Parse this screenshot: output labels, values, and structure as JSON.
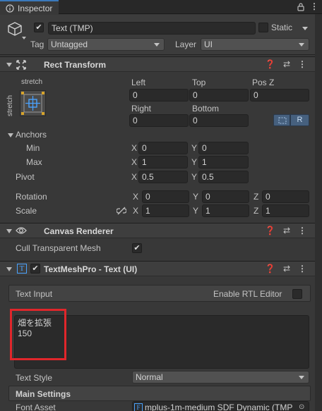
{
  "tab": {
    "title": "Inspector",
    "icon": "info-icon"
  },
  "header_icons": [
    "lock-icon",
    "kebab-menu-icon"
  ],
  "object": {
    "enabled": true,
    "name": "Text (TMP)",
    "static_label": "Static",
    "static_checked": false,
    "tag_label": "Tag",
    "tag_value": "Untagged",
    "layer_label": "Layer",
    "layer_value": "UI"
  },
  "rect_transform": {
    "title": "Rect Transform",
    "anchor_preset_top": "stretch",
    "anchor_preset_side": "stretch",
    "left_label": "Left",
    "left_value": "0",
    "top_label": "Top",
    "top_value": "0",
    "posz_label": "Pos Z",
    "posz_value": "0",
    "right_label": "Right",
    "right_value": "0",
    "bottom_label": "Bottom",
    "bottom_value": "0",
    "r_button": "R",
    "anchors_label": "Anchors",
    "min_label": "Min",
    "min_x": "0",
    "min_y": "0",
    "max_label": "Max",
    "max_x": "1",
    "max_y": "1",
    "pivot_label": "Pivot",
    "pivot_x": "0.5",
    "pivot_y": "0.5",
    "rotation_label": "Rotation",
    "rot_x": "0",
    "rot_y": "0",
    "rot_z": "0",
    "scale_label": "Scale",
    "scale_x": "1",
    "scale_y": "1",
    "scale_z": "1",
    "axis_x": "X",
    "axis_y": "Y",
    "axis_z": "Z"
  },
  "canvas_renderer": {
    "title": "Canvas Renderer",
    "cull_label": "Cull Transparent Mesh",
    "cull_checked": true
  },
  "tmp": {
    "title": "TextMeshPro - Text (UI)",
    "enabled": true,
    "text_input_label": "Text Input",
    "rtl_label": "Enable RTL Editor",
    "rtl_checked": false,
    "text_line1": "畑を拡張",
    "text_line2": "150",
    "text_style_label": "Text Style",
    "text_style_value": "Normal",
    "main_settings_label": "Main Settings",
    "font_asset_label": "Font Asset",
    "font_asset_value": "mplus-1m-medium SDF Dynamic (TMP"
  },
  "colors": {
    "highlight_box": "#e0262b",
    "accent": "#3a79bb"
  }
}
